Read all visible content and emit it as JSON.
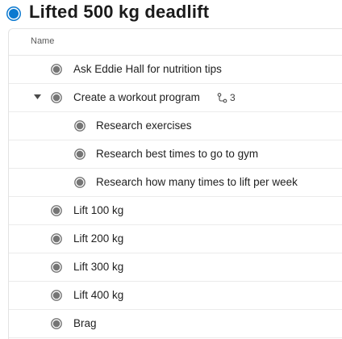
{
  "header": {
    "title": "Lifted 500 kg deadlift",
    "status_color": "#0b79d0"
  },
  "table": {
    "column_name": "Name"
  },
  "rows": [
    {
      "label": "Ask Eddie Hall for nutrition tips",
      "level": 0
    },
    {
      "label": "Create a workout program",
      "level": 0,
      "expanded": true,
      "subtask_count": "3",
      "subtask_icon": "subtask-icon"
    },
    {
      "label": "Research exercises",
      "level": 1
    },
    {
      "label": "Research best times to go to gym",
      "level": 1
    },
    {
      "label": "Research how many times to lift per week",
      "level": 1
    },
    {
      "label": "Lift 100 kg",
      "level": 0
    },
    {
      "label": "Lift 200 kg",
      "level": 0
    },
    {
      "label": "Lift 300 kg",
      "level": 0
    },
    {
      "label": "Lift 400 kg",
      "level": 0
    },
    {
      "label": "Brag",
      "level": 0
    }
  ],
  "icons": {
    "task_status": "circle-status-icon",
    "expand": "chevron-down-icon"
  },
  "colors": {
    "task_circle_fill": "#757575",
    "task_circle_ring": "#757575"
  }
}
